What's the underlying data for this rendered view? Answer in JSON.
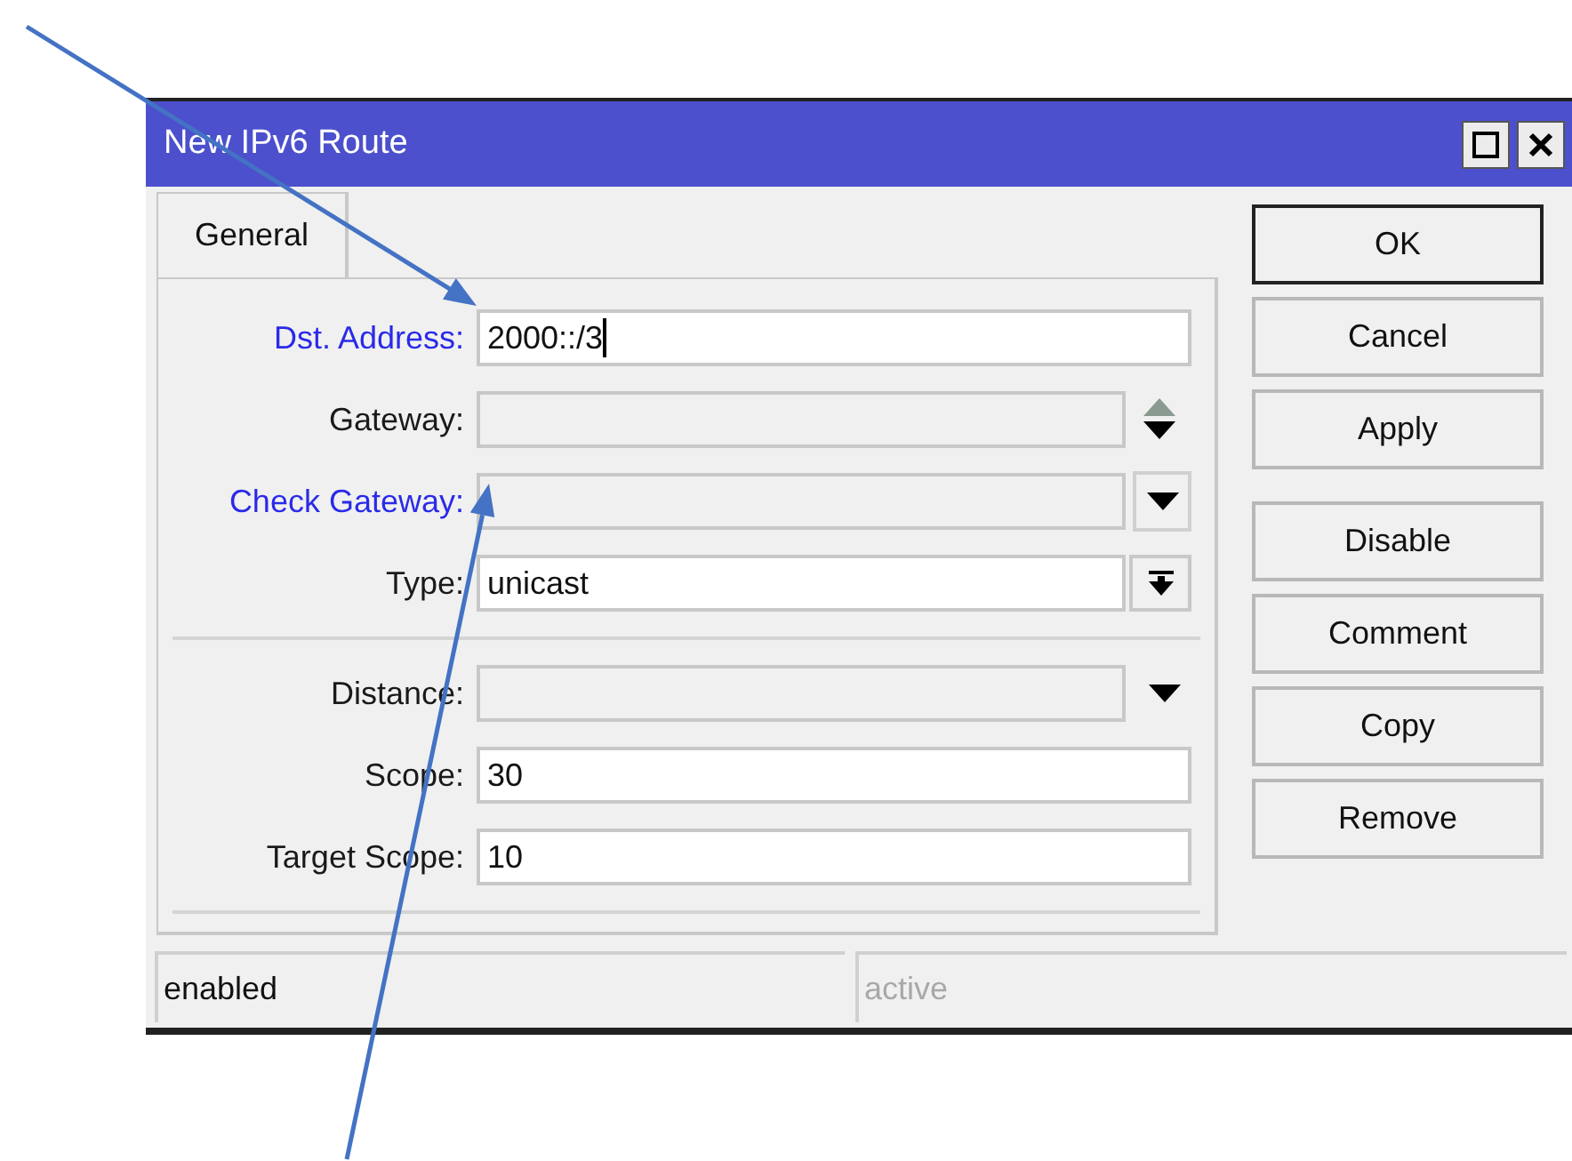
{
  "window": {
    "title": "New IPv6 Route"
  },
  "tabs": [
    {
      "label": "General",
      "selected": true
    }
  ],
  "groups": [
    {
      "fields": [
        {
          "label": "Dst. Address:",
          "highlighted": true,
          "kind": "text",
          "value": "2000::/3",
          "focused": true
        },
        {
          "label": "Gateway:",
          "highlighted": false,
          "kind": "spin"
        },
        {
          "label": "Check Gateway:",
          "highlighted": true,
          "kind": "dropdown-button"
        },
        {
          "label": "Type:",
          "highlighted": false,
          "kind": "select",
          "value": "unicast"
        }
      ]
    },
    {
      "fields": [
        {
          "label": "Distance:",
          "highlighted": false,
          "kind": "dropdown"
        },
        {
          "label": "Scope:",
          "highlighted": false,
          "kind": "text",
          "value": "30",
          "focused": false
        },
        {
          "label": "Target Scope:",
          "highlighted": false,
          "kind": "text",
          "value": "10",
          "focused": false
        }
      ]
    }
  ],
  "button_groups": [
    {
      "buttons": [
        {
          "label": "OK",
          "default": true
        },
        {
          "label": "Cancel",
          "default": false
        },
        {
          "label": "Apply",
          "default": false
        }
      ]
    },
    {
      "buttons": [
        {
          "label": "Disable",
          "default": false
        },
        {
          "label": "Comment",
          "default": false
        },
        {
          "label": "Copy",
          "default": false
        },
        {
          "label": "Remove",
          "default": false
        }
      ]
    }
  ],
  "status_bar": [
    {
      "text": "enabled",
      "disabled": false
    },
    {
      "text": "active",
      "disabled": true
    }
  ]
}
